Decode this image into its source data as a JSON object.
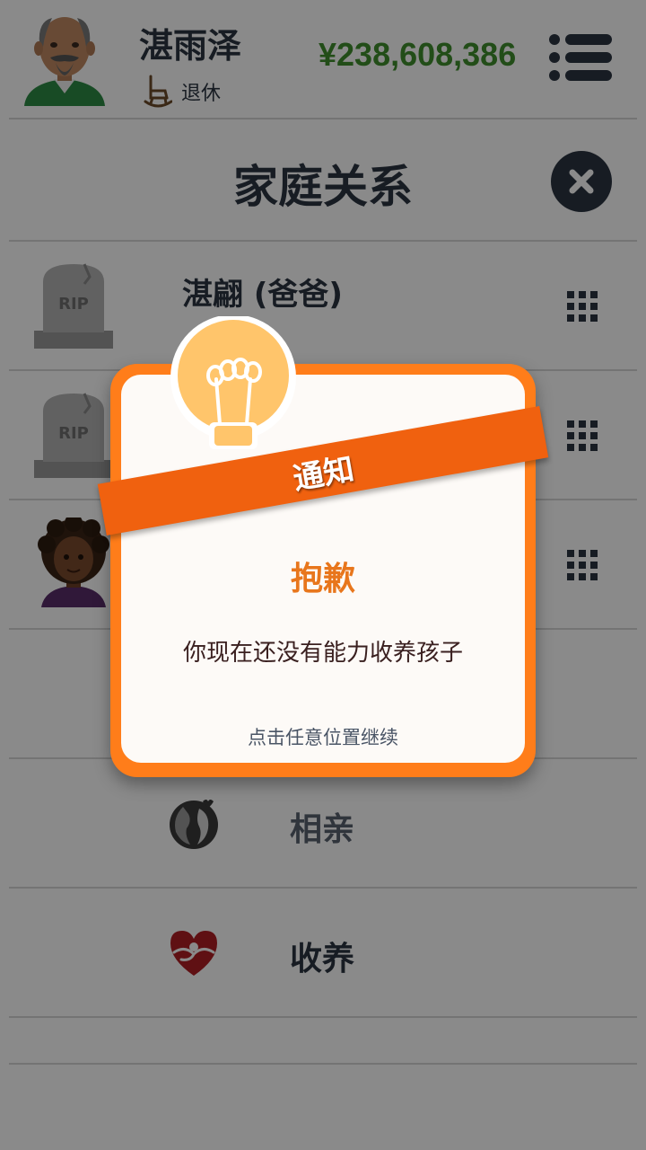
{
  "header": {
    "user_name": "湛雨泽",
    "status_icon": "rocking-chair-icon",
    "status": "退休",
    "money": "¥238,608,386",
    "menu_icon": "menu-list-icon"
  },
  "section": {
    "title": "家庭关系",
    "close_icon": "close-icon"
  },
  "family": {
    "rows": [
      {
        "name": "湛翩 (爸爸)",
        "avatar": "tombstone-icon",
        "avatar_text": "RIP"
      },
      {
        "name": "",
        "avatar": "tombstone-icon",
        "avatar_text": "RIP"
      },
      {
        "name": "",
        "avatar": "woman-avatar"
      }
    ]
  },
  "options": [
    {
      "label": "相亲",
      "icon": "couple-silhouette-icon"
    },
    {
      "label": "收养",
      "icon": "heart-hands-icon"
    }
  ],
  "modal": {
    "banner": "通知",
    "heading": "抱歉",
    "message": "你现在还没有能力收养孩子",
    "hint": "点击任意位置继续",
    "icon": "lightbulb-icon"
  },
  "colors": {
    "money": "#3f8f2e",
    "accent_orange": "#ff7d1a",
    "ribbon": "#f0610f",
    "heading": "#e8761c",
    "text_dark": "#2b3441"
  }
}
